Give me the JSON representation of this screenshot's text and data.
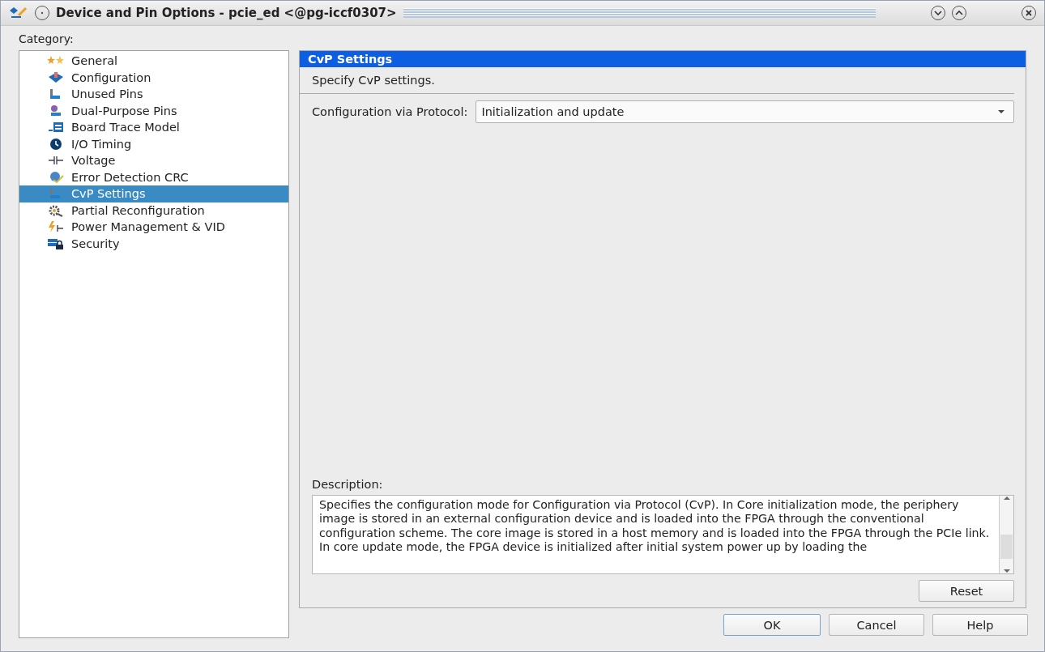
{
  "window": {
    "title": "Device and Pin Options - pcie_ed <@pg-iccf0307>"
  },
  "category_label": "Category:",
  "categories": [
    {
      "label": "General",
      "kind": "stars",
      "selected": false
    },
    {
      "label": "Configuration",
      "kind": "chip",
      "selected": false
    },
    {
      "label": "Unused Pins",
      "kind": "pin",
      "selected": false
    },
    {
      "label": "Dual-Purpose Pins",
      "kind": "pin2",
      "selected": false
    },
    {
      "label": "Board Trace Model",
      "kind": "board",
      "selected": false
    },
    {
      "label": "I/O Timing",
      "kind": "clock",
      "selected": false
    },
    {
      "label": "Voltage",
      "kind": "voltage",
      "selected": false
    },
    {
      "label": "Error Detection CRC",
      "kind": "crc",
      "selected": false
    },
    {
      "label": "CvP Settings",
      "kind": "pin",
      "selected": true
    },
    {
      "label": "Partial Reconfiguration",
      "kind": "gear",
      "selected": false
    },
    {
      "label": "Power Management & VID",
      "kind": "power",
      "selected": false
    },
    {
      "label": "Security",
      "kind": "lock",
      "selected": false
    }
  ],
  "panel": {
    "title": "CvP Settings",
    "subtitle": "Specify CvP settings.",
    "field_label": "Configuration via Protocol:",
    "field_value": "Initialization and update",
    "description_label": "Description:",
    "description": "Specifies the configuration mode for Configuration via Protocol (CvP). In Core initialization mode, the periphery image is stored in an external configuration device and is loaded into the FPGA through the conventional configuration scheme. The core image is stored in a host memory and is loaded into the FPGA through the PCIe link. In core update mode, the FPGA device is initialized after initial system power up by loading the",
    "reset_button": "Reset"
  },
  "buttons": [
    {
      "label": "OK",
      "default": true
    },
    {
      "label": "Cancel",
      "default": false
    },
    {
      "label": "Help",
      "default": false
    }
  ]
}
